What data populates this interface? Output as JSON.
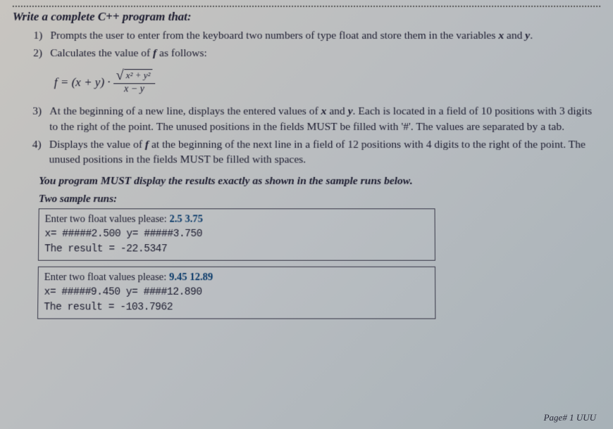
{
  "title": "Write a complete C++ program that:",
  "items": [
    {
      "n": "1)",
      "html": "Prompts the user to enter from the keyboard two numbers of type float and store them in the variables <span class='ital'>x</span> and <span class='ital'>y</span>."
    },
    {
      "n": "2)",
      "html": "Calculates the value of <span class='ital'>f</span> as follows:"
    }
  ],
  "formula": {
    "lhs": "f = (x + y) ·",
    "sqrt_inner": "x² + y²",
    "denom": "x − y"
  },
  "items2": [
    {
      "n": "3)",
      "html": "At the beginning of a new line, displays the entered values of <span class='ital'>x</span> and <span class='ital'>y</span>. Each is located in a field of 10 positions with 3 digits to the right of the point. The unused positions in the fields MUST be filled with '#'. The values are separated by a tab."
    },
    {
      "n": "4)",
      "html": "Displays the value of <span class='ital'>f</span> at the beginning of the next line in a field of 12 positions with 4 digits to the right of the point. The unused positions in the fields MUST be filled with spaces."
    }
  ],
  "emph": "You program MUST display the results exactly as shown in the sample runs below.",
  "subhead": "Two sample runs:",
  "run1": {
    "l1a": "Enter two float values please: ",
    "l1b": "2.5 3.75",
    "l2": "x= #####2.500  y= #####3.750",
    "l3": "The result =    -22.5347"
  },
  "run2": {
    "l1a": "Enter two float values please: ",
    "l1b": "9.45 12.89",
    "l2": "x= #####9.450  y= ####12.890",
    "l3": "The result =   -103.7962"
  },
  "footer": "Page# 1   UUU"
}
